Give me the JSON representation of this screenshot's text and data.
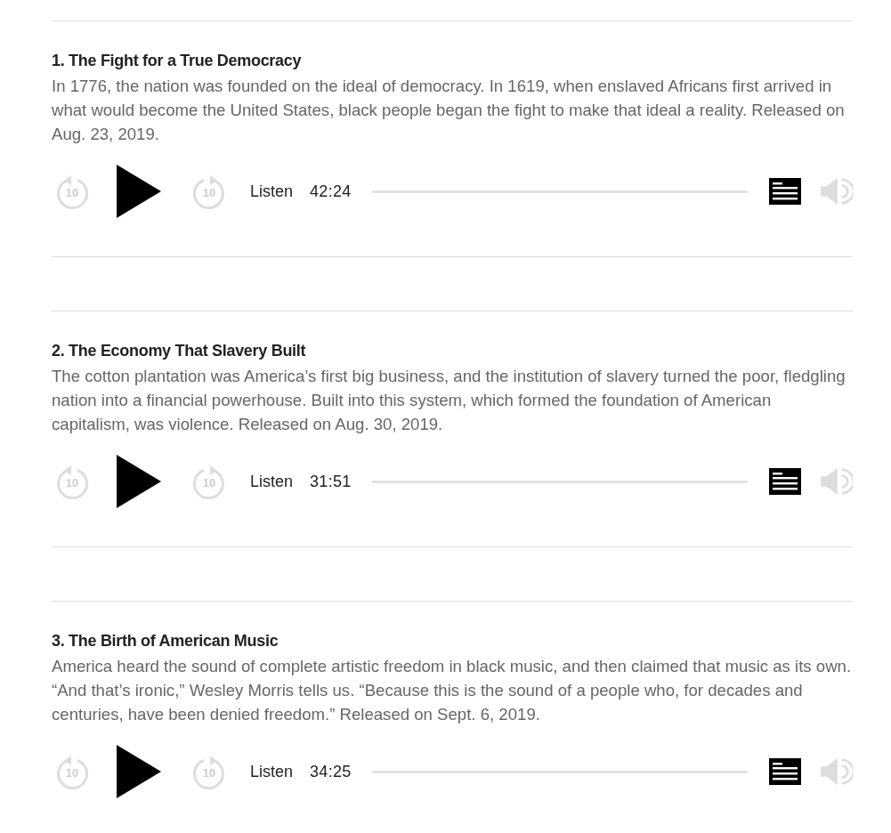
{
  "episodes": [
    {
      "title": "1. The Fight for a True Democracy",
      "description": "In 1776, the nation was founded on the ideal of democracy. In 1619, when enslaved Africans first arrived in what would become the United States, black people began the fight to make that ideal a reality. Released on Aug. 23, 2019.",
      "player": {
        "skip_back": "10",
        "skip_forward": "10",
        "listen": "Listen",
        "duration": "42:24",
        "level": 0
      }
    },
    {
      "title": "2. The Economy That Slavery Built",
      "description": "The cotton plantation was America’s first big business, and the institution of slavery turned the poor, fledgling nation into a financial powerhouse. Built into this system, which formed the foundation of American capitalism, was violence. Released on Aug. 30, 2019.",
      "player": {
        "skip_back": "10",
        "skip_forward": "10",
        "listen": "Listen",
        "duration": "31:51",
        "level": 0
      }
    },
    {
      "title": "3. The Birth of American Music",
      "description": "America heard the sound of complete artistic freedom in black music, and then claimed that music as its own. “And that’s ironic,” Wesley Morris tells us. “Because this is the sound of a people who, for decades and centuries, have been denied freedom.” Released on Sept. 6, 2019.",
      "player": {
        "skip_back": "10",
        "skip_forward": "10",
        "listen": "Listen",
        "duration": "34:25",
        "level": 0
      }
    }
  ]
}
